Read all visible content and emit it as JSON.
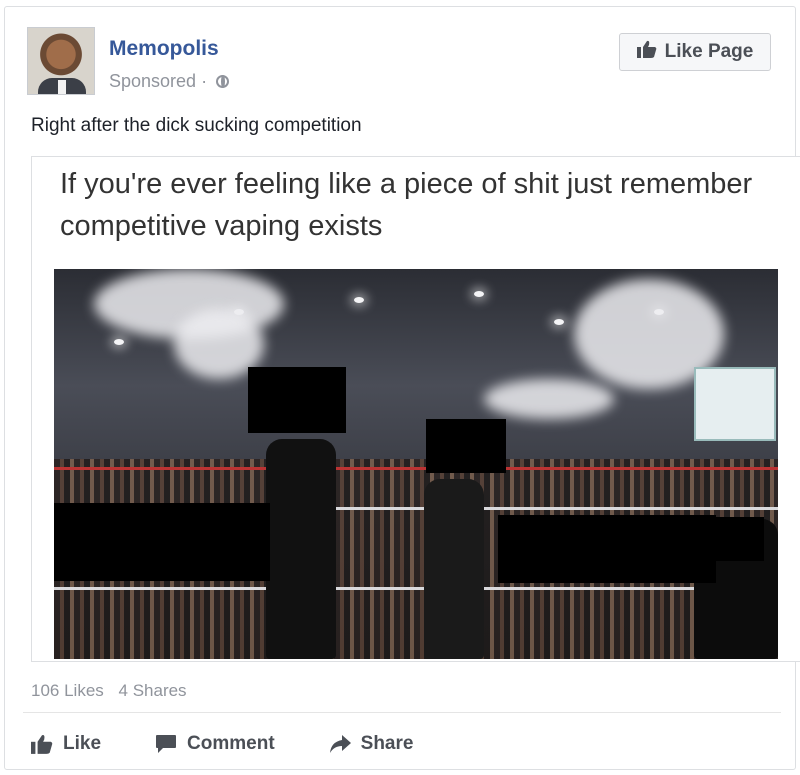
{
  "post": {
    "page_name": "Memopolis",
    "sponsored_label": "Sponsored",
    "separator": "·",
    "like_page_label": "Like Page",
    "caption": "Right after the dick sucking competition",
    "meme_text": "If you're ever feeling like a piece of shit just remember competitive vaping exists"
  },
  "stats": {
    "likes": "106 Likes",
    "shares": "4 Shares"
  },
  "actions": {
    "like": "Like",
    "comment": "Comment",
    "share": "Share"
  },
  "icons": {
    "like": "thumbs-up-icon",
    "comment": "speech-bubble-icon",
    "share": "share-arrow-icon",
    "privacy": "globe-icon"
  },
  "colors": {
    "link": "#365899",
    "meta": "#90949c",
    "action": "#4b4f56"
  }
}
